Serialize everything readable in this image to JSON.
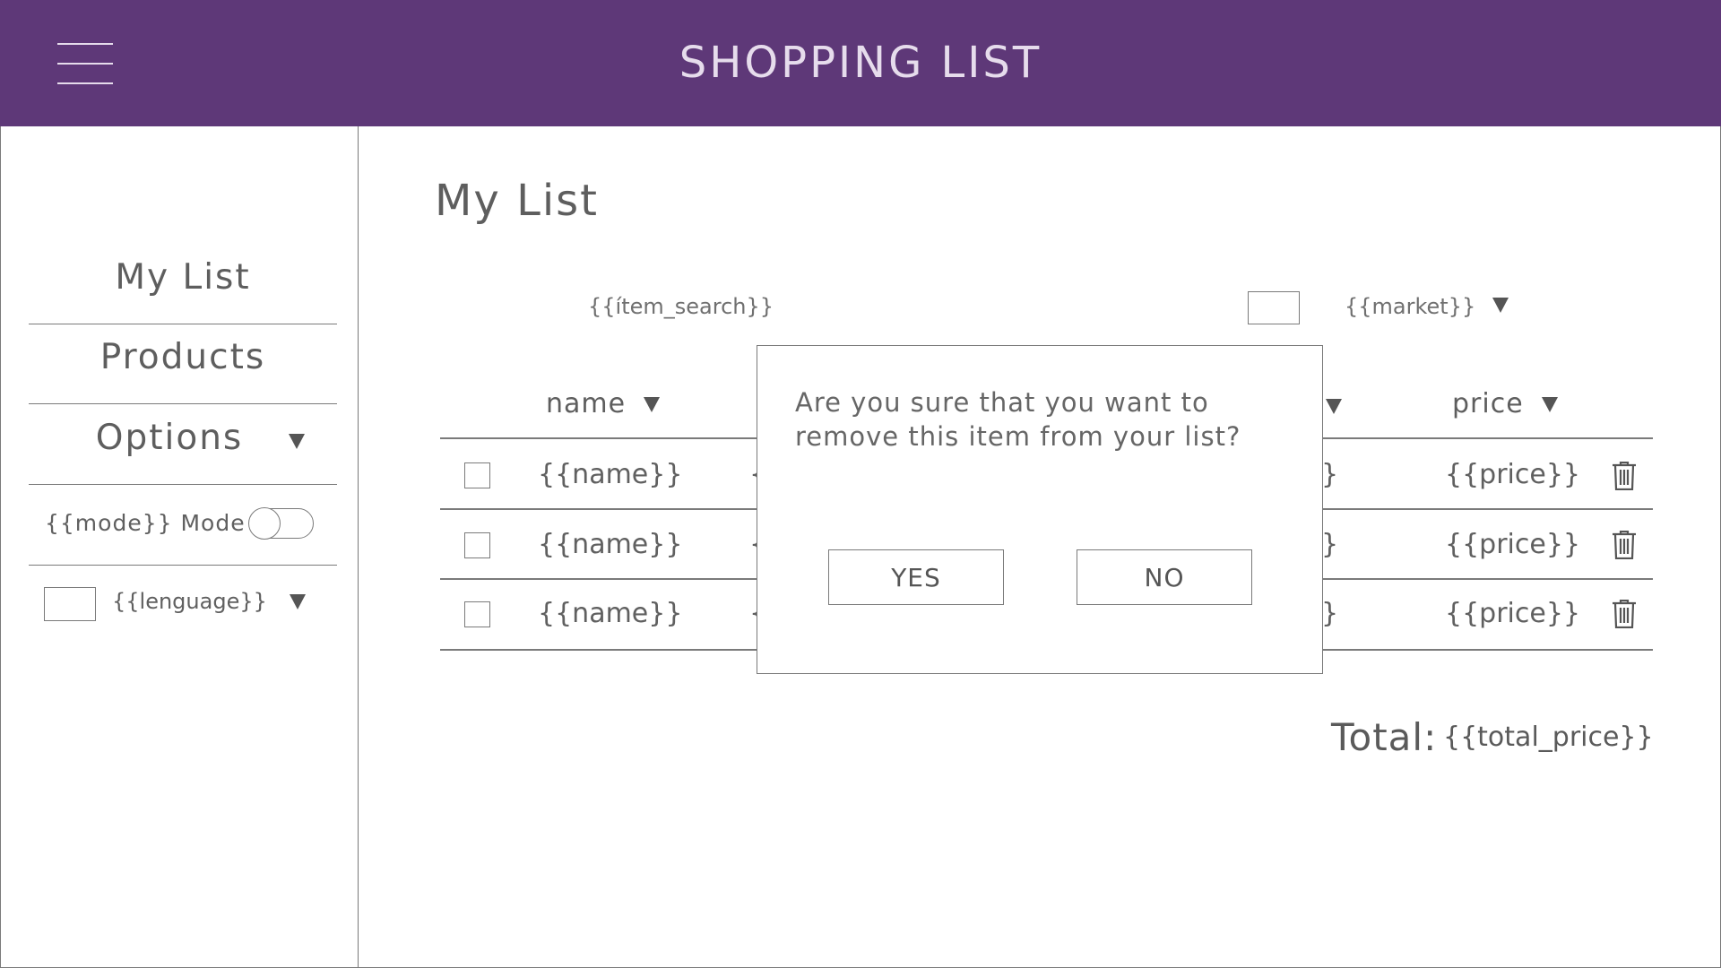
{
  "header": {
    "title": "SHOPPING LIST",
    "menu_icon": "hamburger-menu-icon"
  },
  "sidebar": {
    "items": [
      {
        "label": "My List"
      },
      {
        "label": "Products"
      },
      {
        "label": "Options"
      }
    ],
    "mode_label": "{{mode}} Mode",
    "language_label": "{{lenguage}}"
  },
  "main": {
    "title": "My List",
    "search_text": "{{ítem_search}}",
    "market_label": "{{market}}",
    "columns": {
      "name": "name",
      "price": "price"
    },
    "rows": [
      {
        "name": "{{name}}",
        "price": "{{price}}",
        "frag_left": "{",
        "frag_right": "}"
      },
      {
        "name": "{{name}}",
        "price": "{{price}}",
        "frag_left": "{",
        "frag_right": "}"
      },
      {
        "name": "{{name}}",
        "price": "{{price}}",
        "frag_left": "{",
        "frag_right": "}"
      }
    ],
    "total_label": "Total:",
    "total_value": "{{total_price}}"
  },
  "modal": {
    "message": "Are you sure that you want to remove this item from your list?",
    "yes_label": "YES",
    "no_label": "NO"
  },
  "colors": {
    "header_bg": "#5e3878",
    "header_text": "#e6dcec",
    "line": "#7a7a7a"
  }
}
